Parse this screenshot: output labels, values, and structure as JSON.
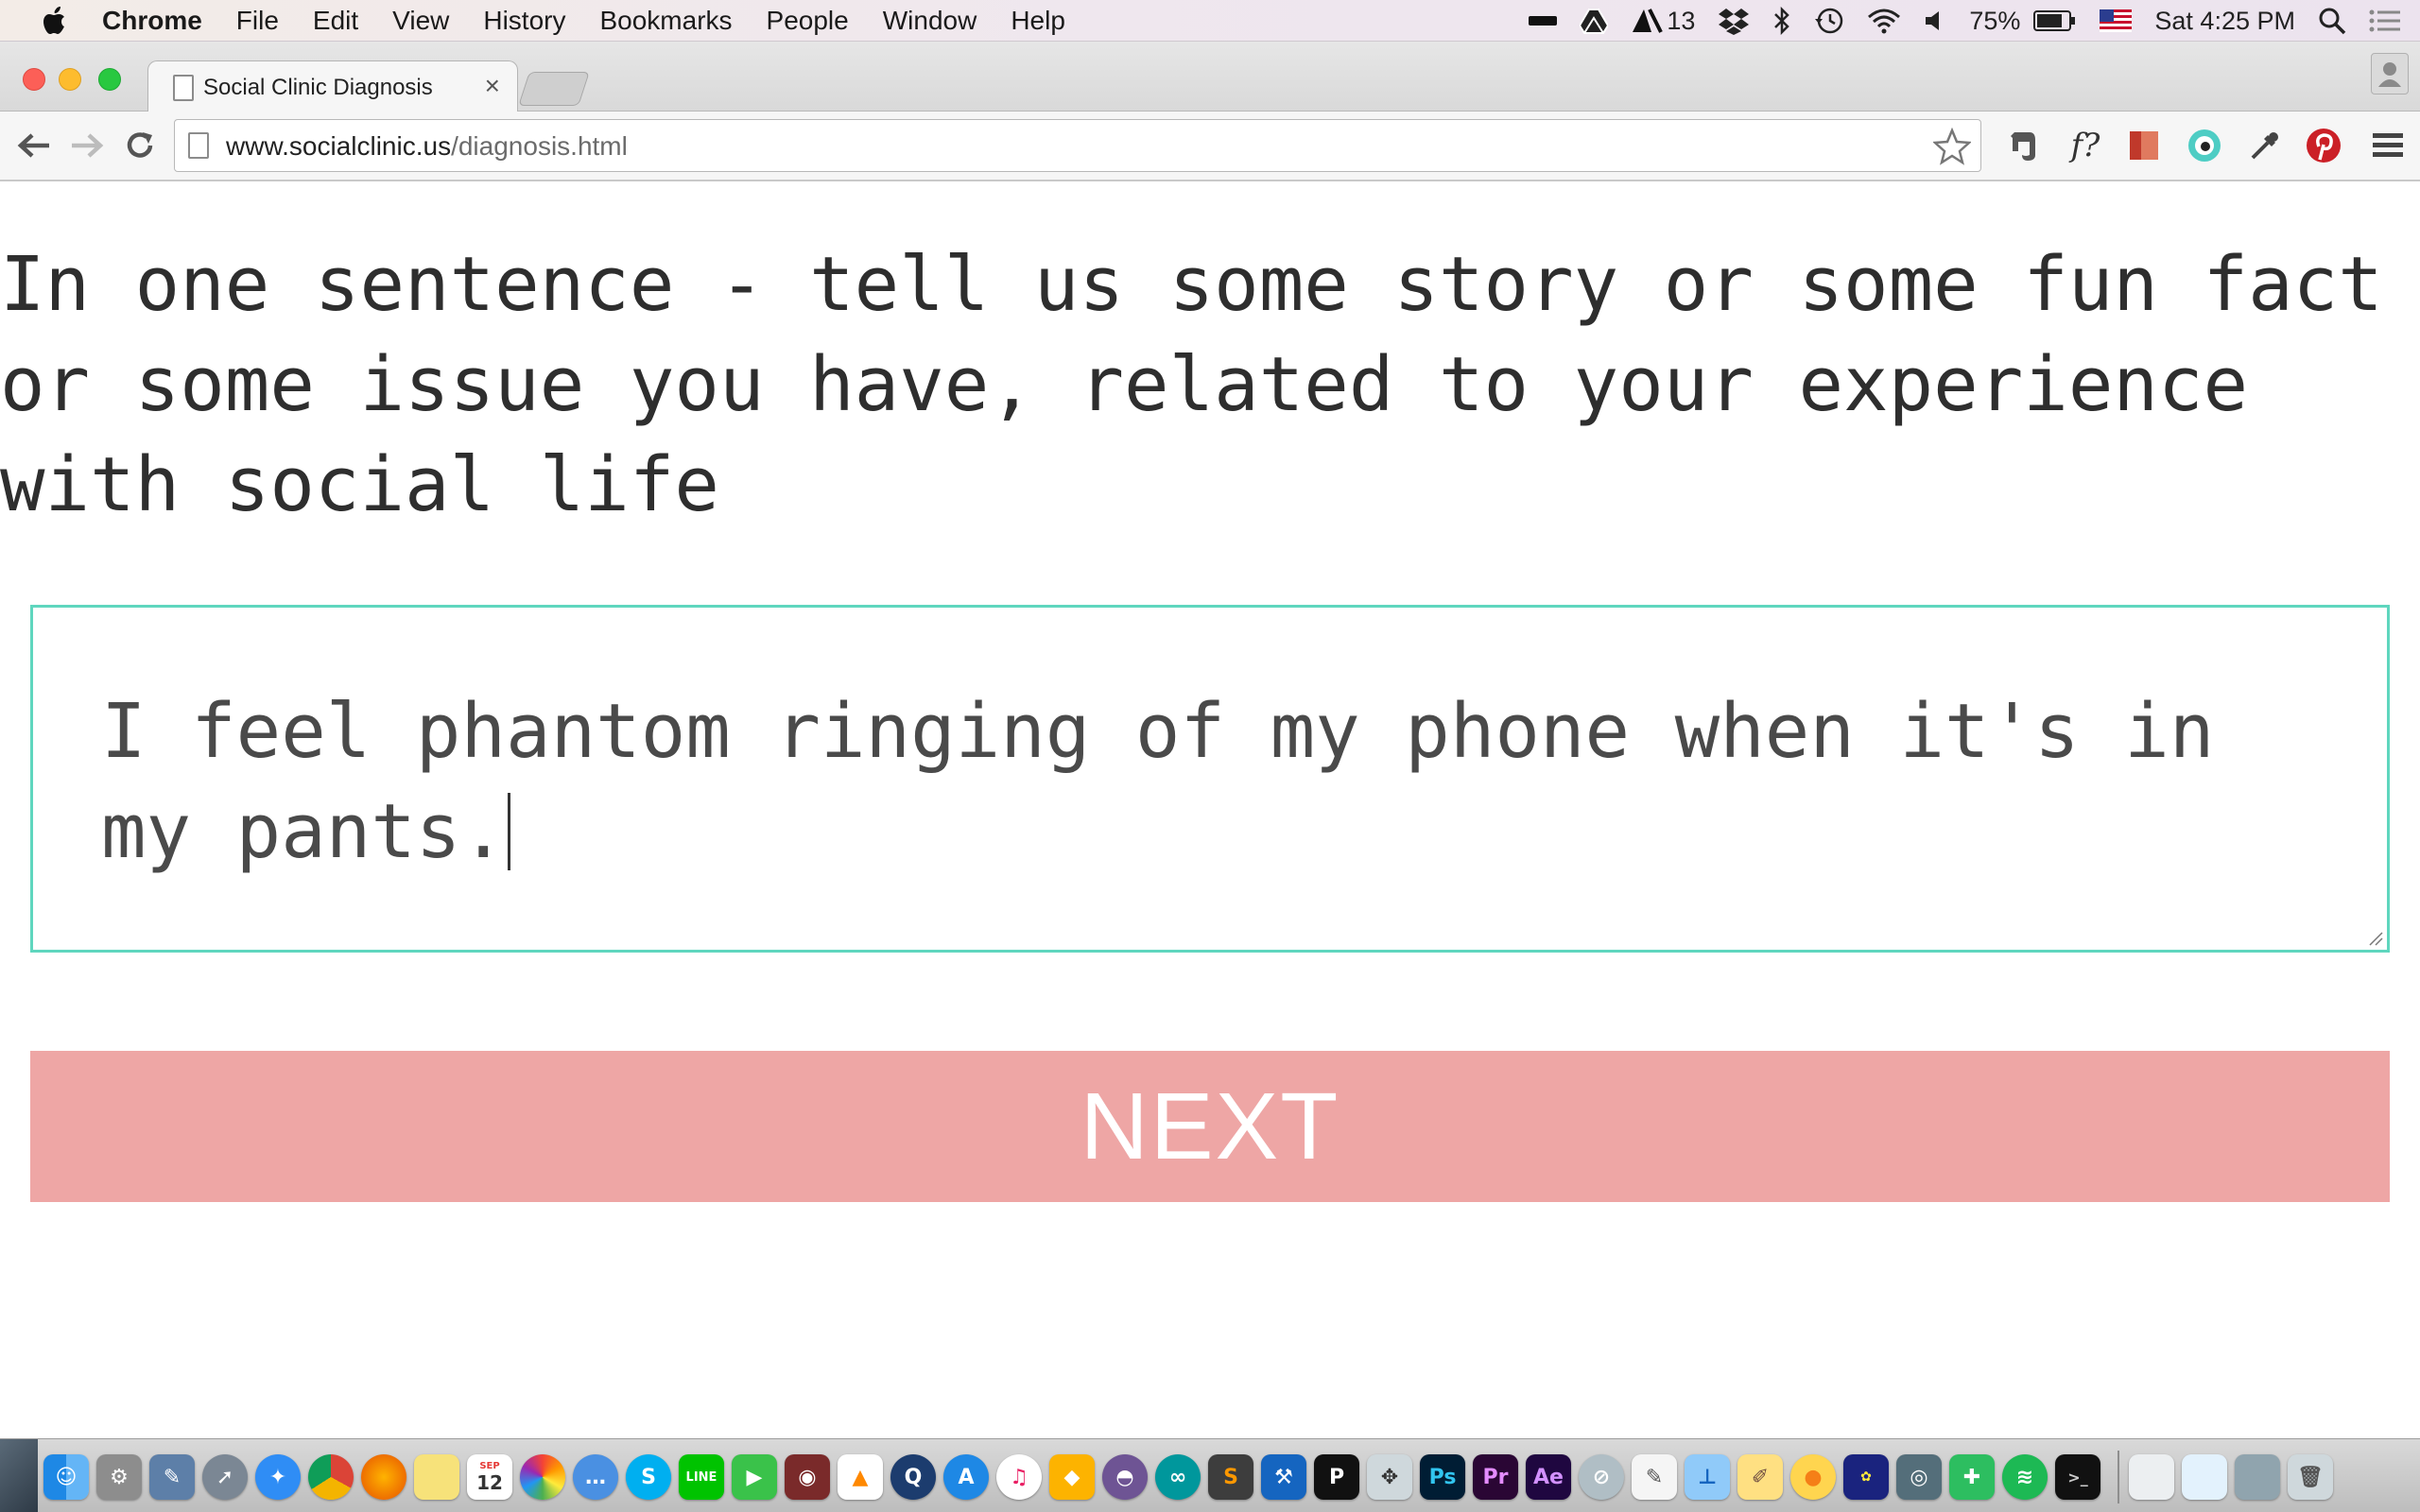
{
  "menubar": {
    "app_name": "Chrome",
    "menus": [
      "File",
      "Edit",
      "View",
      "History",
      "Bookmarks",
      "People",
      "Window",
      "Help"
    ],
    "status": {
      "adobe_count": "13",
      "battery": "75%",
      "clock": "Sat 4:25 PM"
    }
  },
  "browser": {
    "tab_title": "Social Clinic Diagnosis",
    "tab_close": "×",
    "url_host": "www.socialclinic.us",
    "url_path": "/diagnosis.html",
    "ext_fquestion": "f?"
  },
  "page": {
    "prompt_lines": [
      "In one sentence - tell us some story or some fun fact",
      "or some issue you have, related to your experience",
      "with social life"
    ],
    "answer_lines": [
      "I feel phantom ringing of my phone when it's in",
      "my pants."
    ],
    "next_label": "NEXT",
    "colors": {
      "input_border": "#5fd6be",
      "next_background": "#eea6a5",
      "next_text": "#ffffff"
    }
  },
  "dock": {
    "calendar_month": "SEP",
    "calendar_day": "12"
  }
}
